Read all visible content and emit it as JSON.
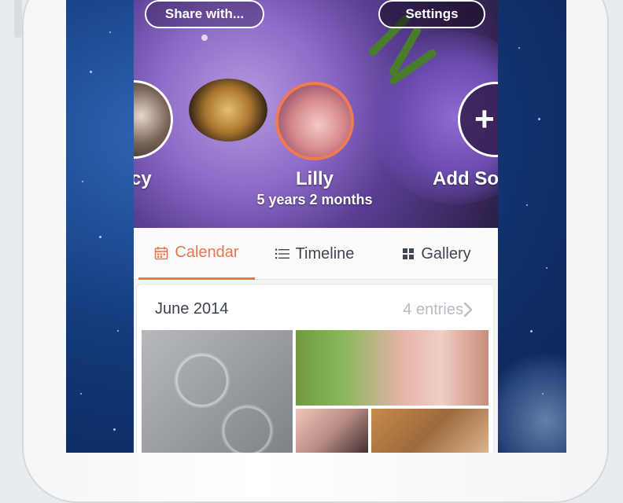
{
  "header": {
    "share_label": "Share with...",
    "settings_label": "Settings"
  },
  "profiles": {
    "left_name_partial": "cy",
    "main_name": "Lilly",
    "main_age": "5 years 2 months",
    "add_label_partial": "Add So",
    "add_icon": "+"
  },
  "tabs": [
    {
      "label": "Calendar",
      "icon": "calendar-icon",
      "active": true
    },
    {
      "label": "Timeline",
      "icon": "list-icon",
      "active": false
    },
    {
      "label": "Gallery",
      "icon": "grid-icon",
      "active": false
    }
  ],
  "entries": {
    "month": "June 2014",
    "count_label": "4 entries"
  },
  "colors": {
    "accent": "#e8754e",
    "tab_text": "#3f4553",
    "muted": "#b8bcc6"
  }
}
